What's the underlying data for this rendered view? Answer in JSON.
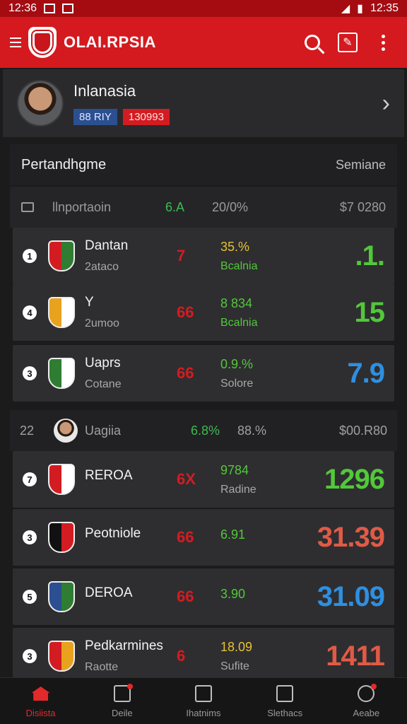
{
  "status_bar": {
    "time_left": "12:36",
    "time_right": "12:35"
  },
  "app": {
    "title": "OLAI.RPSIA"
  },
  "profile": {
    "name": "Inlanasia",
    "badge_blue": "88 RIY",
    "badge_red": "130993"
  },
  "section": {
    "title": "Pertandhgme",
    "link": "Semiane"
  },
  "header1": {
    "label": "llnportaoin",
    "col2": "6.A",
    "col3": "20/0%",
    "col4": "$7 0280"
  },
  "rows": [
    {
      "rank": "1",
      "name": "Dantan",
      "sub": "2ataco",
      "odd": "7",
      "stat": "35.%",
      "stat_label": "Bcalnia",
      "big": ".1.",
      "big_color": "#52c83a",
      "stat_color": "#e6c232",
      "crest_a": "#d31c22",
      "crest_b": "#2f7d32"
    },
    {
      "rank": "4",
      "name": "Y",
      "sub": "2umoo",
      "odd": "66",
      "stat": "8 834",
      "stat_label": "Bcalnia",
      "big": "15",
      "big_color": "#52c83a",
      "stat_color": "#52c83a",
      "crest_a": "#e8a21d",
      "crest_b": "#ffffff"
    },
    {
      "rank": "3",
      "name": "Uaprs",
      "sub": "Cotane",
      "odd": "66",
      "stat": "0.9.%",
      "stat_label": "Solore",
      "big": "7.9",
      "big_color": "#2f8fe0",
      "stat_color": "#52c83a",
      "crest_a": "#2f7d32",
      "crest_b": "#ffffff"
    }
  ],
  "header2": {
    "rank": "22",
    "label": "Uagiia",
    "col2": "6.8%",
    "col3": "88.%",
    "col4": "$00.R80"
  },
  "rows2": [
    {
      "rank": "7",
      "name": "REROA",
      "sub": "",
      "odd": "6X",
      "stat": "9784",
      "stat_label": "Radine",
      "big": "1296",
      "big_color": "#52c83a",
      "stat_color": "#52c83a",
      "crest_a": "#d31c22",
      "crest_b": "#ffffff"
    },
    {
      "rank": "3",
      "name": "Peotniole",
      "sub": "",
      "odd": "66",
      "stat": "6.91",
      "stat_label": "",
      "big": "31.39",
      "big_color": "#e15a46",
      "stat_color": "#52c83a",
      "crest_a": "#111111",
      "crest_b": "#d31c22"
    },
    {
      "rank": "5",
      "name": "DEROA",
      "sub": "",
      "odd": "66",
      "stat": "3.90",
      "stat_label": "",
      "big": "31.09",
      "big_color": "#2f8fe0",
      "stat_color": "#52c83a",
      "crest_a": "#2b4f91",
      "crest_b": "#2f7d32"
    },
    {
      "rank": "3",
      "name": "Pedkarmines",
      "sub": "Raotte",
      "odd": "6",
      "stat": "18.09",
      "stat_label": "Sufite",
      "big": "1411",
      "big_color": "#e15a46",
      "stat_color": "#e6c232",
      "crest_a": "#d31c22",
      "crest_b": "#e8a21d"
    }
  ],
  "nav": [
    {
      "label": "Disiista",
      "active": true
    },
    {
      "label": "Deile",
      "active": false
    },
    {
      "label": "Ihatnims",
      "active": false
    },
    {
      "label": "Slethacs",
      "active": false
    },
    {
      "label": "Aeabe",
      "active": false
    }
  ]
}
